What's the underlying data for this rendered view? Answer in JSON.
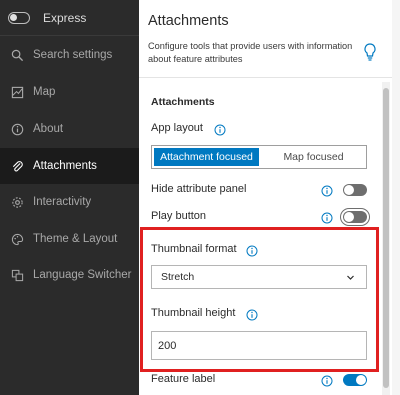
{
  "sidebar": {
    "express_label": "Express",
    "items": [
      {
        "label": "Search settings",
        "icon": "search-icon"
      },
      {
        "label": "Map",
        "icon": "map-icon"
      },
      {
        "label": "About",
        "icon": "info-icon"
      },
      {
        "label": "Attachments",
        "icon": "paperclip-icon",
        "active": true
      },
      {
        "label": "Interactivity",
        "icon": "gear-icon"
      },
      {
        "label": "Theme & Layout",
        "icon": "palette-icon"
      },
      {
        "label": "Language Switcher",
        "icon": "translate-icon"
      }
    ]
  },
  "main": {
    "title": "Attachments",
    "description": "Configure tools that provide users with information about feature attributes",
    "section_title": "Attachments",
    "app_layout": {
      "label": "App layout",
      "options": [
        "Attachment focused",
        "Map focused"
      ],
      "selected": "Attachment focused"
    },
    "hide_attribute_panel": {
      "label": "Hide attribute panel",
      "enabled": false
    },
    "play_button": {
      "label": "Play button",
      "enabled": false
    },
    "thumbnail_format": {
      "label": "Thumbnail format",
      "value": "Stretch"
    },
    "thumbnail_height": {
      "label": "Thumbnail height",
      "value": "200"
    },
    "feature_label": {
      "label": "Feature label",
      "enabled": true
    }
  },
  "colors": {
    "accent": "#0079c1",
    "highlight": "#e02020",
    "sidebar_bg": "#2b2b2b"
  }
}
